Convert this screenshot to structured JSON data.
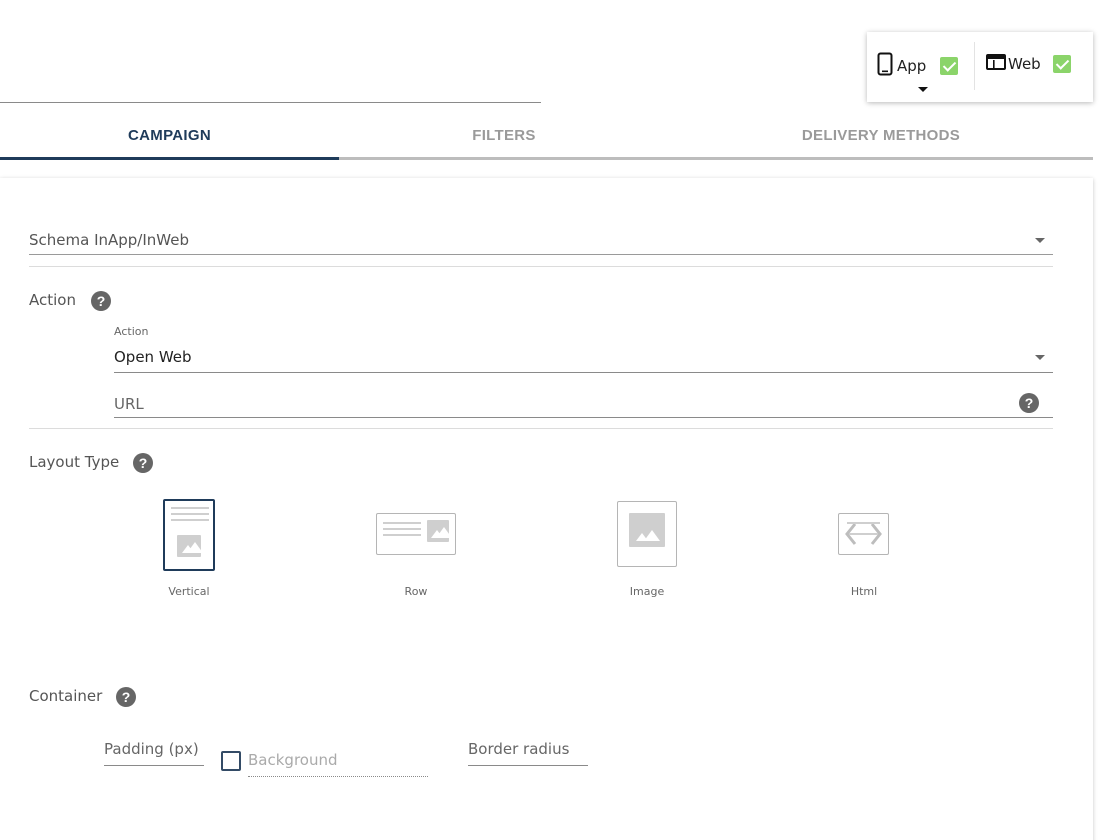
{
  "channels": {
    "app": {
      "label": "App",
      "icon": "mobile-phone-icon",
      "checked": true
    },
    "web": {
      "label": "Web",
      "icon": "browser-window-icon",
      "checked": true
    },
    "check_color": "#8bd46a"
  },
  "tabs": [
    {
      "label": "CAMPAIGN",
      "active": true
    },
    {
      "label": "FILTERS",
      "active": false
    },
    {
      "label": "DELIVERY METHODS",
      "active": false
    }
  ],
  "accent_color": "#1f3b5a",
  "schema": {
    "placeholder": "Schema InApp/InWeb"
  },
  "action_section": {
    "title": "Action",
    "help_icon": "question-circle-icon",
    "action_field": {
      "label": "Action",
      "value": "Open Web"
    },
    "url_field": {
      "placeholder": "URL",
      "help_icon": "question-circle-icon"
    }
  },
  "layout_section": {
    "title": "Layout Type",
    "help_icon": "question-circle-icon",
    "options": [
      {
        "label": "Vertical",
        "icon": "layout-vertical-icon",
        "selected": true
      },
      {
        "label": "Row",
        "icon": "layout-row-icon",
        "selected": false
      },
      {
        "label": "Image",
        "icon": "layout-image-icon",
        "selected": false
      },
      {
        "label": "Html",
        "icon": "layout-html-icon",
        "selected": false
      }
    ]
  },
  "container_section": {
    "title": "Container",
    "help_icon": "question-circle-icon",
    "padding": {
      "placeholder": "Padding (px)"
    },
    "background": {
      "placeholder": "Background",
      "checked": false
    },
    "border_radius": {
      "placeholder": "Border radius"
    }
  },
  "help_glyph": "?"
}
